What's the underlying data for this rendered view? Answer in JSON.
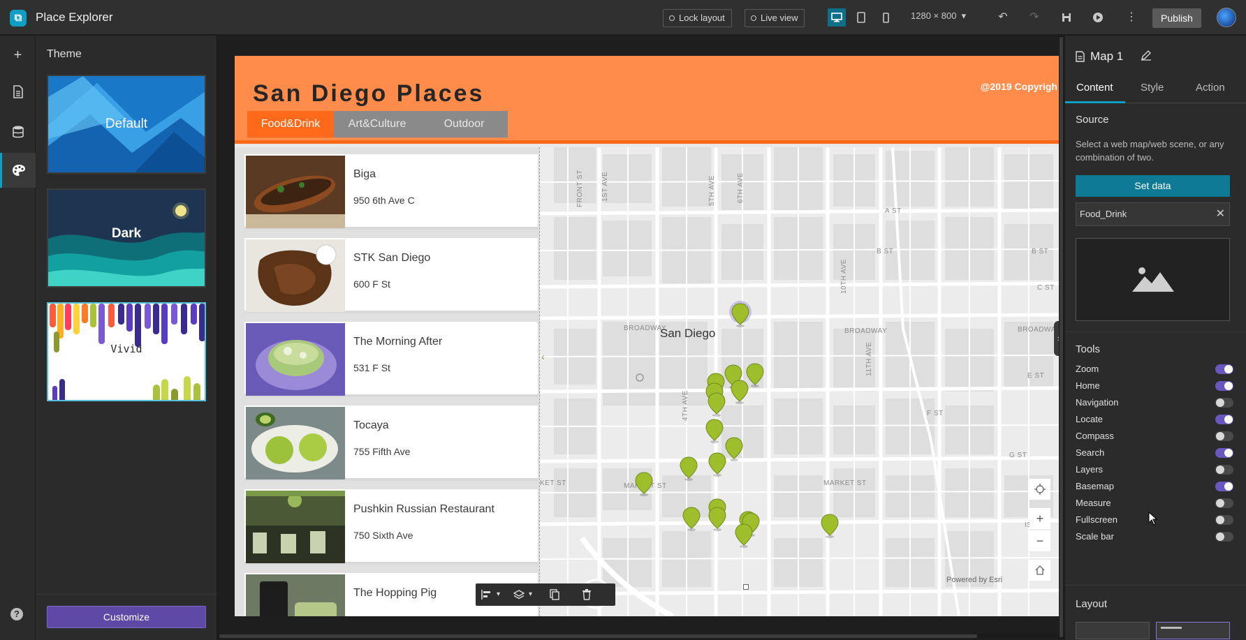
{
  "app": {
    "title": "Place Explorer",
    "logo_icon": "app-logo-icon"
  },
  "topbar": {
    "lock_layout": "Lock layout",
    "live_view": "Live view",
    "resolution": "1280 × 800",
    "publish": "Publish",
    "devices": [
      "desktop-icon",
      "tablet-icon",
      "phone-icon"
    ],
    "actions": [
      "undo-icon",
      "redo-icon",
      "save-icon",
      "preview-icon",
      "more-icon"
    ]
  },
  "rail": {
    "items": [
      "add-icon",
      "page-icon",
      "data-icon",
      "theme-icon"
    ],
    "help": "?"
  },
  "theme_panel": {
    "title": "Theme",
    "themes": [
      {
        "label": "Default",
        "selected": false
      },
      {
        "label": "Dark",
        "selected": false
      },
      {
        "label": "Vivid",
        "selected": true
      }
    ],
    "customize": "Customize"
  },
  "page": {
    "title": "San Diego Places",
    "copyright": "@2019 Copyrigh",
    "tabs": [
      {
        "label": "Food&Drink",
        "active": true
      },
      {
        "label": "Art&Culture",
        "active": false
      },
      {
        "label": "Outdoor",
        "active": false
      }
    ],
    "places": [
      {
        "name": "Biga",
        "address": "950 6th Ave C"
      },
      {
        "name": "STK San Diego",
        "address": "600 F St"
      },
      {
        "name": "The Morning After",
        "address": "531 F St"
      },
      {
        "name": "Tocaya",
        "address": "755 Fifth Ave"
      },
      {
        "name": "Pushkin Russian Restaurant",
        "address": "750 Sixth Ave"
      },
      {
        "name": "The Hopping Pig",
        "address": ""
      }
    ],
    "colors": {
      "header": "#ff8c4b",
      "accent": "#ff6a1a",
      "pin": "#9fbe2c"
    }
  },
  "map": {
    "city": "San Diego",
    "streets": {
      "front": "FRONT ST",
      "first": "1ST AVE",
      "fifth": "5TH AVE",
      "sixth": "6TH AVE",
      "tenth": "10TH AVE",
      "eleventh": "11TH AVE",
      "fourth": "4TH AVE",
      "a": "A ST",
      "b1": "B ST",
      "b2": "B ST",
      "c": "C ST",
      "broadway1": "BROADWAY",
      "broadway2": "BROADWAY",
      "broadway3": "BROADWAY",
      "e": "E ST",
      "f": "F ST",
      "g": "G ST",
      "market1": "KET ST",
      "market2": "MARKET ST",
      "market3": "MARKET ST",
      "island": "ISLA"
    },
    "powered_by": "Powered by Esri",
    "controls": [
      "locate-icon",
      "zoom-in-icon",
      "zoom-out-icon",
      "home-icon"
    ]
  },
  "floating_toolbar": [
    "align-icon",
    "layers-icon",
    "copy-icon",
    "delete-icon"
  ],
  "settings": {
    "title": "Map 1",
    "tabs": [
      {
        "label": "Content",
        "active": true
      },
      {
        "label": "Style",
        "active": false
      },
      {
        "label": "Action",
        "active": false
      }
    ],
    "source_label": "Source",
    "source_help": "Select a web map/web scene, or any combination of two.",
    "set_data": "Set data",
    "source_value": "Food_Drink",
    "tools_label": "Tools",
    "tools": [
      {
        "label": "Zoom",
        "on": true
      },
      {
        "label": "Home",
        "on": true
      },
      {
        "label": "Navigation",
        "on": false
      },
      {
        "label": "Locate",
        "on": true
      },
      {
        "label": "Compass",
        "on": false
      },
      {
        "label": "Search",
        "on": true
      },
      {
        "label": "Layers",
        "on": false
      },
      {
        "label": "Basemap",
        "on": true
      },
      {
        "label": "Measure",
        "on": false
      },
      {
        "label": "Fullscreen",
        "on": false
      },
      {
        "label": "Scale bar",
        "on": false
      }
    ],
    "layout_label": "Layout"
  }
}
